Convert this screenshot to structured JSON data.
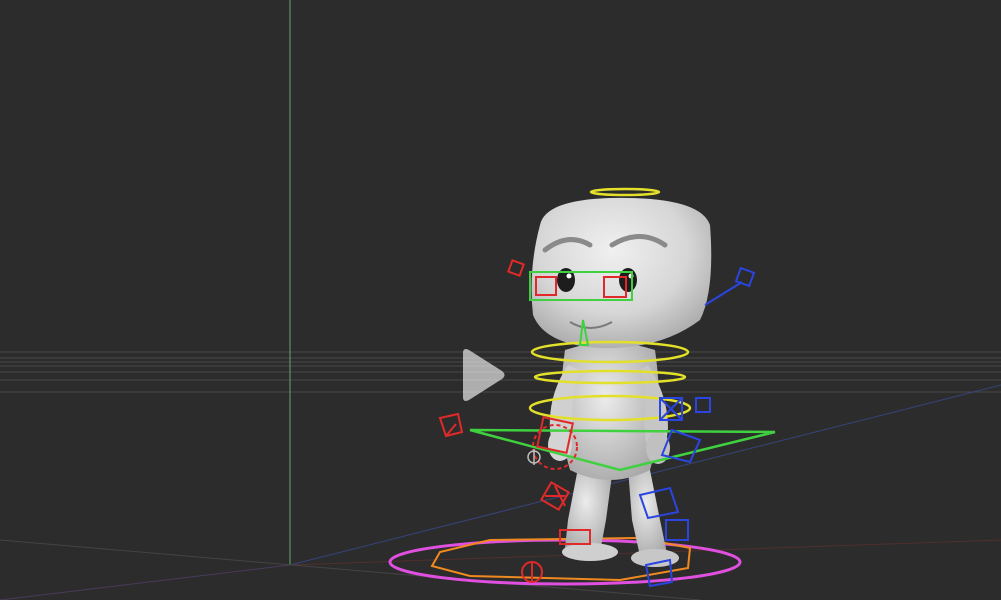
{
  "viewport": {
    "background": "#2c2c2c",
    "grid_color": "#6a6a6a",
    "axis_colors": {
      "y": "#5fa86a",
      "x": "#8a3a3a",
      "z": "#3b4f9e"
    }
  },
  "character": {
    "skin_color": "#d9d9d9",
    "shadow_color": "#9a9a9a"
  },
  "rig_controls": {
    "colors": {
      "center": "#e3e02a",
      "face": "#3fd13f",
      "left": "#e02a2a",
      "right": "#2a45e0",
      "root": "#e050e0",
      "root_inner": "#f08a20"
    },
    "icon_names": [
      "head-control-icon",
      "eye-control-icon",
      "spine-control-icon",
      "hip-control-icon",
      "ik-hand-control-icon",
      "ik-foot-control-icon",
      "root-control-icon"
    ]
  },
  "player": {
    "play_icon": "play-icon",
    "play_color": "#ffffff"
  }
}
